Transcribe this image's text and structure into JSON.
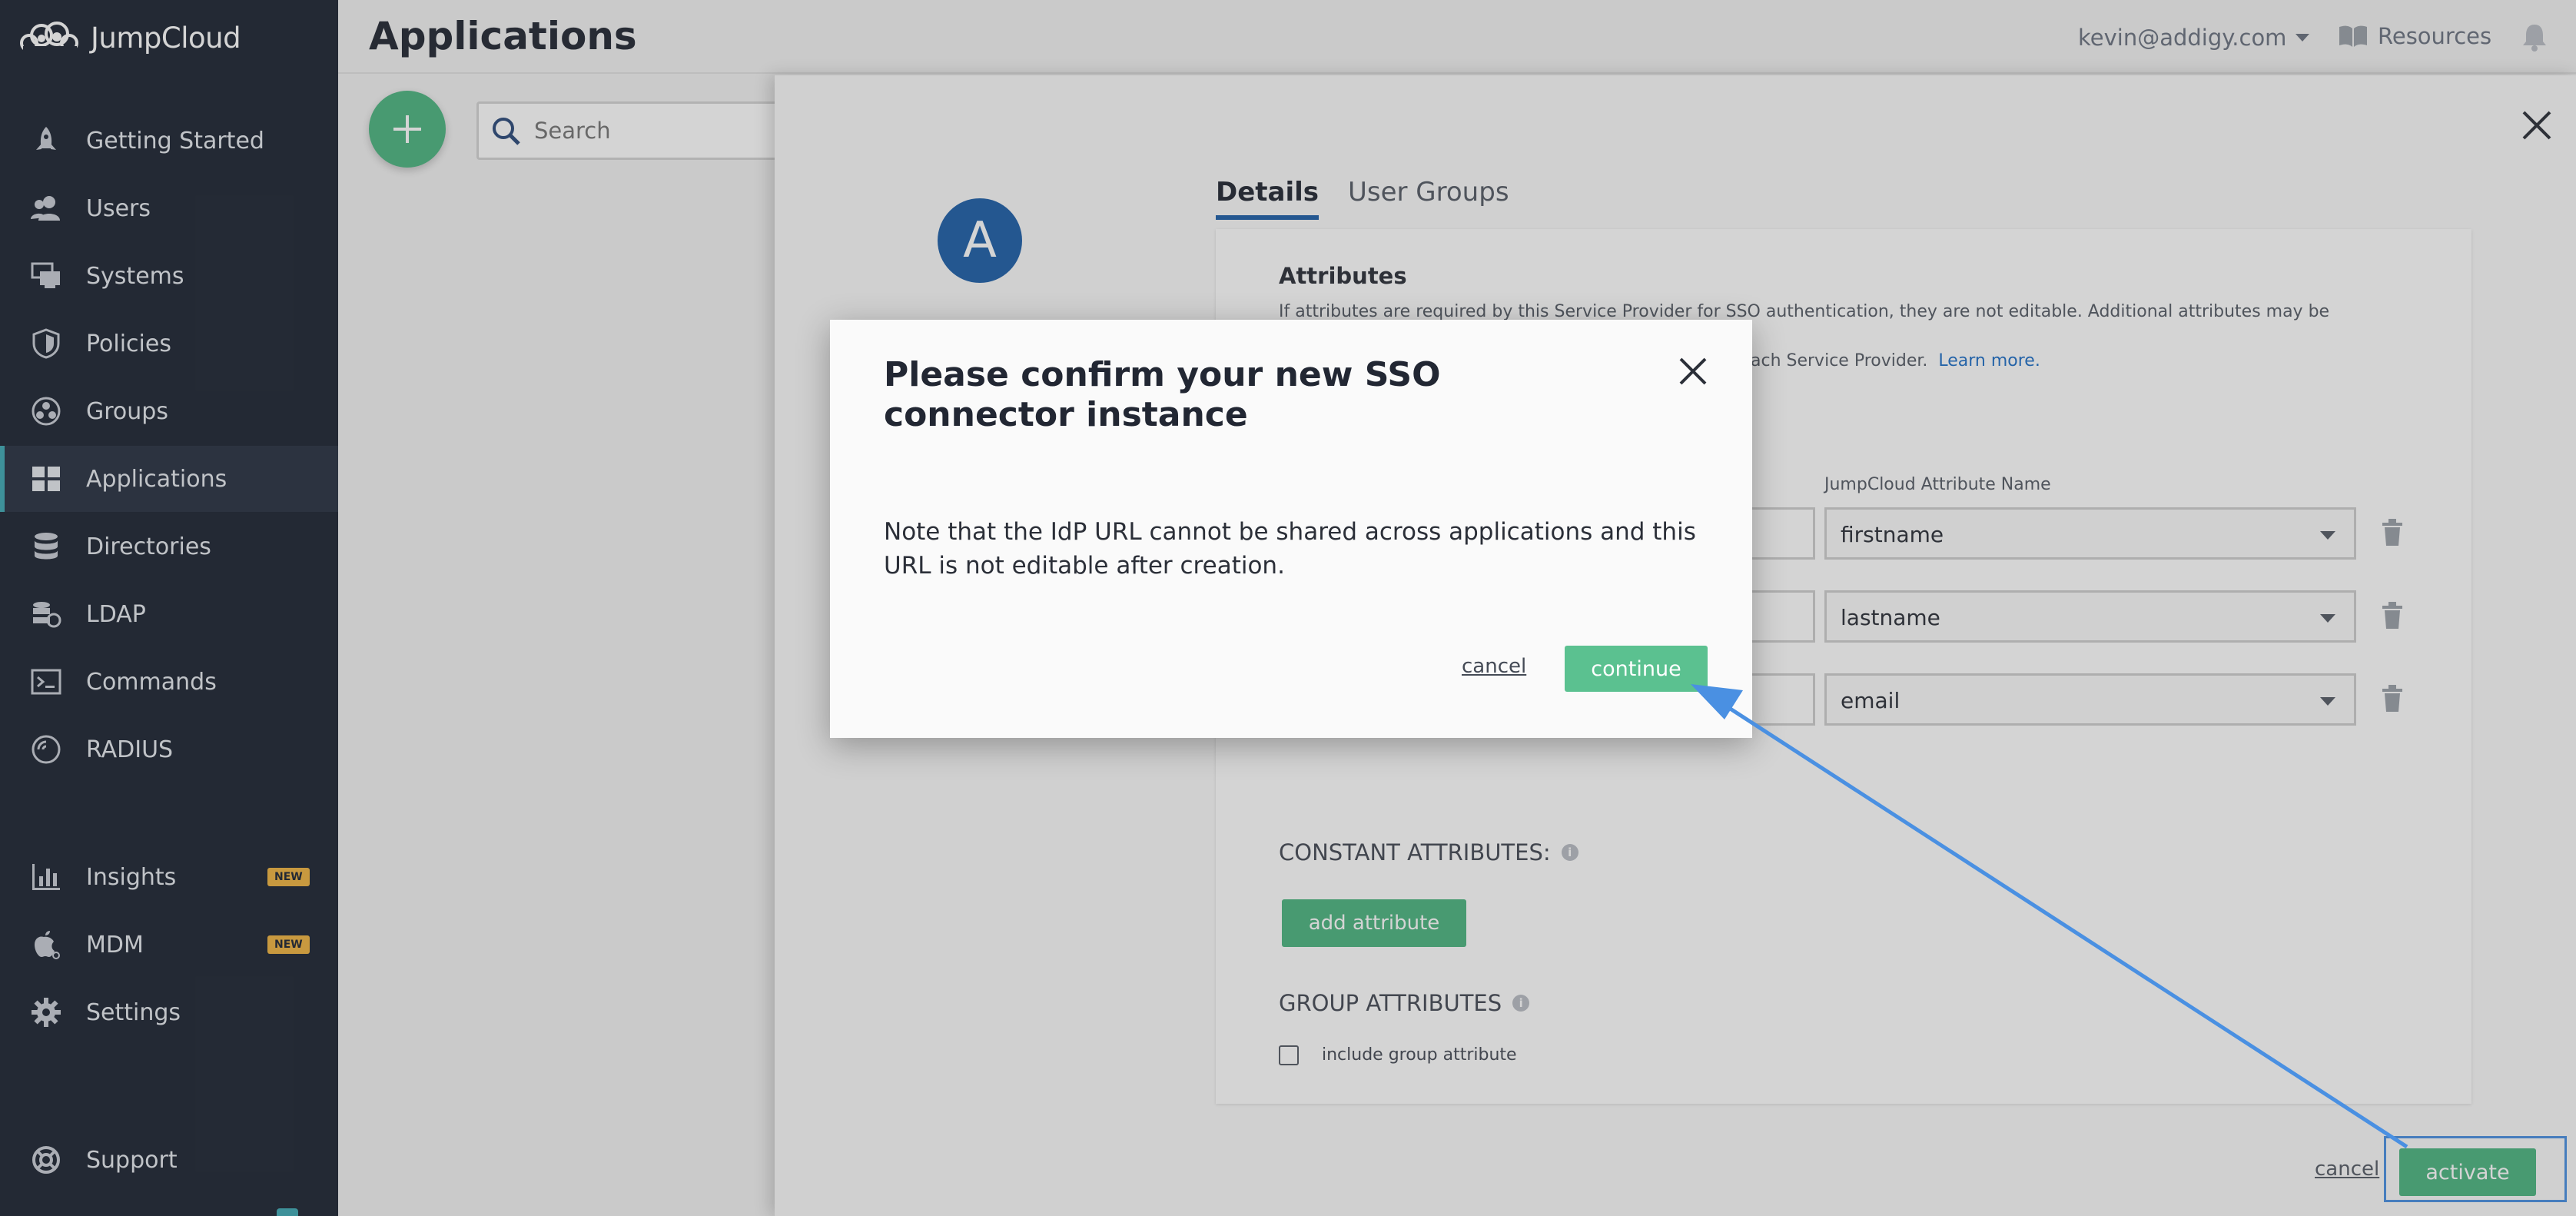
{
  "brand": {
    "name": "JumpCloud"
  },
  "sidebar": {
    "items": [
      {
        "key": "getting-started",
        "label": "Getting Started",
        "icon": "rocket-icon",
        "active": false,
        "badge": ""
      },
      {
        "key": "users",
        "label": "Users",
        "icon": "users-icon",
        "active": false,
        "badge": ""
      },
      {
        "key": "systems",
        "label": "Systems",
        "icon": "systems-icon",
        "active": false,
        "badge": ""
      },
      {
        "key": "policies",
        "label": "Policies",
        "icon": "shield-icon",
        "active": false,
        "badge": ""
      },
      {
        "key": "groups",
        "label": "Groups",
        "icon": "groups-icon",
        "active": false,
        "badge": ""
      },
      {
        "key": "applications",
        "label": "Applications",
        "icon": "applications-icon",
        "active": true,
        "badge": ""
      },
      {
        "key": "directories",
        "label": "Directories",
        "icon": "database-icon",
        "active": false,
        "badge": ""
      },
      {
        "key": "ldap",
        "label": "LDAP",
        "icon": "ldap-icon",
        "active": false,
        "badge": ""
      },
      {
        "key": "commands",
        "label": "Commands",
        "icon": "terminal-icon",
        "active": false,
        "badge": ""
      },
      {
        "key": "radius",
        "label": "RADIUS",
        "icon": "radius-icon",
        "active": false,
        "badge": ""
      },
      {
        "key": "insights",
        "label": "Insights",
        "icon": "bar-chart-icon",
        "active": false,
        "badge": "NEW"
      },
      {
        "key": "mdm",
        "label": "MDM",
        "icon": "apple-icon",
        "active": false,
        "badge": "NEW"
      },
      {
        "key": "settings",
        "label": "Settings",
        "icon": "gear-icon",
        "active": false,
        "badge": ""
      },
      {
        "key": "support",
        "label": "Support",
        "icon": "lifebuoy-icon",
        "active": false,
        "badge": ""
      }
    ]
  },
  "header": {
    "title": "Applications",
    "user_email": "kevin@addigy.com",
    "resources_label": "Resources"
  },
  "toolbar": {
    "search_placeholder": "Search"
  },
  "panel": {
    "avatar_letter": "A",
    "tabs": [
      "Details",
      "User Groups"
    ],
    "attributes_title": "Attributes",
    "attributes_desc_line1": "If attributes are required by this Service Provider for SSO authentication, they are not editable. Additional attributes may be included in",
    "attributes_desc_line2": "ach Service Provider.",
    "learn_more": "Learn more.",
    "jc_attr_column": "JumpCloud Attribute Name",
    "attribute_rows": [
      "firstname",
      "lastname",
      "email"
    ],
    "constant_attributes_label": "CONSTANT ATTRIBUTES:",
    "add_attribute_label": "add attribute",
    "group_attributes_label": "GROUP ATTRIBUTES",
    "include_group_label": "include group attribute",
    "info_glyph": "i",
    "cancel_label": "cancel",
    "activate_label": "activate"
  },
  "modal": {
    "title": "Please confirm your new SSO connector instance",
    "body": "Note that the IdP URL cannot be shared across applications and this URL is not editable after creation.",
    "cancel_label": "cancel",
    "continue_label": "continue"
  },
  "colors": {
    "sidebar_bg": "#1d2533",
    "accent_green": "#4cb580",
    "accent_blue": "#1e5fa8",
    "annotation_blue": "#4a90e2"
  }
}
